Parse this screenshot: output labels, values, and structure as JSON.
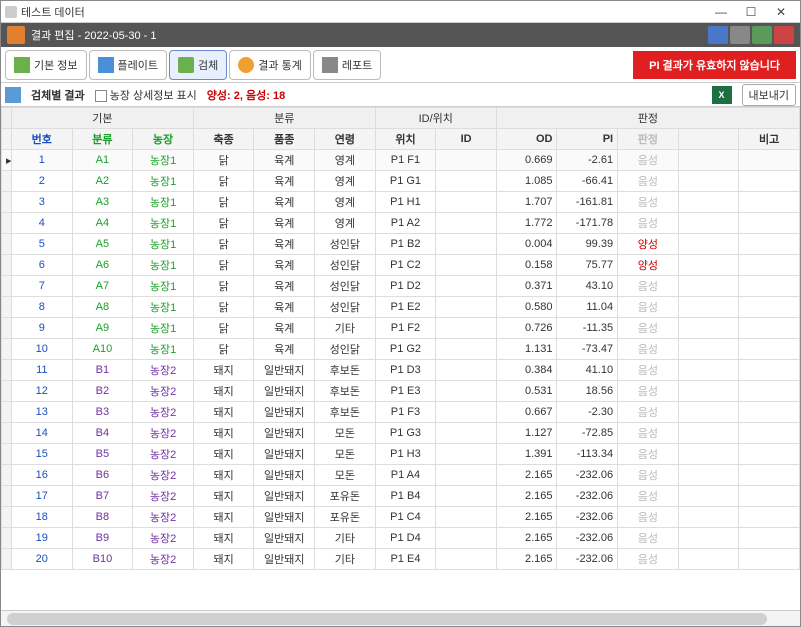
{
  "window": {
    "title": "테스트 데이터"
  },
  "editbar": {
    "title": "결과 편집 - 2022-05-30 - 1"
  },
  "toolbar": {
    "b1": "기본 정보",
    "b2": "플레이트",
    "b3": "검체",
    "b4": "결과 통계",
    "b5": "레포트",
    "warn": "PI 결과가 유효하지 않습니다"
  },
  "subbar": {
    "title": "검체별 결과",
    "chk_label": "농장 상세정보 표시",
    "stats": "양성: 2, 음성: 18",
    "export": "내보내기"
  },
  "group_headers": {
    "g1": "기본",
    "g2": "분류",
    "g3": "ID/위치",
    "g4": "판정"
  },
  "headers": {
    "seq": "번호",
    "cls": "분류",
    "farm": "농장",
    "sp": "축종",
    "br": "품종",
    "age": "연령",
    "pos": "위치",
    "id": "ID",
    "od": "OD",
    "pi": "PI",
    "jd": "판정",
    "note": "비고"
  },
  "rows": [
    {
      "n": "1",
      "c": "A1",
      "farm": "농장1",
      "sp": "닭",
      "br": "육계",
      "age": "영계",
      "pos": "P1 F1",
      "id": "",
      "od": "0.669",
      "pi": "-2.61",
      "jd": "음성",
      "fc": "g"
    },
    {
      "n": "2",
      "c": "A2",
      "farm": "농장1",
      "sp": "닭",
      "br": "육계",
      "age": "영계",
      "pos": "P1 G1",
      "id": "",
      "od": "1.085",
      "pi": "-66.41",
      "jd": "음성",
      "fc": "g"
    },
    {
      "n": "3",
      "c": "A3",
      "farm": "농장1",
      "sp": "닭",
      "br": "육계",
      "age": "영계",
      "pos": "P1 H1",
      "id": "",
      "od": "1.707",
      "pi": "-161.81",
      "jd": "음성",
      "fc": "g"
    },
    {
      "n": "4",
      "c": "A4",
      "farm": "농장1",
      "sp": "닭",
      "br": "육계",
      "age": "영계",
      "pos": "P1 A2",
      "id": "",
      "od": "1.772",
      "pi": "-171.78",
      "jd": "음성",
      "fc": "g"
    },
    {
      "n": "5",
      "c": "A5",
      "farm": "농장1",
      "sp": "닭",
      "br": "육계",
      "age": "성인닭",
      "pos": "P1 B2",
      "id": "",
      "od": "0.004",
      "pi": "99.39",
      "jd": "양성",
      "fc": "g",
      "pos_jd": true
    },
    {
      "n": "6",
      "c": "A6",
      "farm": "농장1",
      "sp": "닭",
      "br": "육계",
      "age": "성인닭",
      "pos": "P1 C2",
      "id": "",
      "od": "0.158",
      "pi": "75.77",
      "jd": "양성",
      "fc": "g",
      "pos_jd": true
    },
    {
      "n": "7",
      "c": "A7",
      "farm": "농장1",
      "sp": "닭",
      "br": "육계",
      "age": "성인닭",
      "pos": "P1 D2",
      "id": "",
      "od": "0.371",
      "pi": "43.10",
      "jd": "음성",
      "fc": "g"
    },
    {
      "n": "8",
      "c": "A8",
      "farm": "농장1",
      "sp": "닭",
      "br": "육계",
      "age": "성인닭",
      "pos": "P1 E2",
      "id": "",
      "od": "0.580",
      "pi": "11.04",
      "jd": "음성",
      "fc": "g"
    },
    {
      "n": "9",
      "c": "A9",
      "farm": "농장1",
      "sp": "닭",
      "br": "육계",
      "age": "기타",
      "pos": "P1 F2",
      "id": "",
      "od": "0.726",
      "pi": "-11.35",
      "jd": "음성",
      "fc": "g"
    },
    {
      "n": "10",
      "c": "A10",
      "farm": "농장1",
      "sp": "닭",
      "br": "육계",
      "age": "성인닭",
      "pos": "P1 G2",
      "id": "",
      "od": "1.131",
      "pi": "-73.47",
      "jd": "음성",
      "fc": "g"
    },
    {
      "n": "11",
      "c": "B1",
      "farm": "농장2",
      "sp": "돼지",
      "br": "일반돼지",
      "age": "후보돈",
      "pos": "P1 D3",
      "id": "",
      "od": "0.384",
      "pi": "41.10",
      "jd": "음성",
      "fc": "p"
    },
    {
      "n": "12",
      "c": "B2",
      "farm": "농장2",
      "sp": "돼지",
      "br": "일반돼지",
      "age": "후보돈",
      "pos": "P1 E3",
      "id": "",
      "od": "0.531",
      "pi": "18.56",
      "jd": "음성",
      "fc": "p"
    },
    {
      "n": "13",
      "c": "B3",
      "farm": "농장2",
      "sp": "돼지",
      "br": "일반돼지",
      "age": "후보돈",
      "pos": "P1 F3",
      "id": "",
      "od": "0.667",
      "pi": "-2.30",
      "jd": "음성",
      "fc": "p"
    },
    {
      "n": "14",
      "c": "B4",
      "farm": "농장2",
      "sp": "돼지",
      "br": "일반돼지",
      "age": "모돈",
      "pos": "P1 G3",
      "id": "",
      "od": "1.127",
      "pi": "-72.85",
      "jd": "음성",
      "fc": "p"
    },
    {
      "n": "15",
      "c": "B5",
      "farm": "농장2",
      "sp": "돼지",
      "br": "일반돼지",
      "age": "모돈",
      "pos": "P1 H3",
      "id": "",
      "od": "1.391",
      "pi": "-113.34",
      "jd": "음성",
      "fc": "p"
    },
    {
      "n": "16",
      "c": "B6",
      "farm": "농장2",
      "sp": "돼지",
      "br": "일반돼지",
      "age": "모돈",
      "pos": "P1 A4",
      "id": "",
      "od": "2.165",
      "pi": "-232.06",
      "jd": "음성",
      "fc": "p"
    },
    {
      "n": "17",
      "c": "B7",
      "farm": "농장2",
      "sp": "돼지",
      "br": "일반돼지",
      "age": "포유돈",
      "pos": "P1 B4",
      "id": "",
      "od": "2.165",
      "pi": "-232.06",
      "jd": "음성",
      "fc": "p"
    },
    {
      "n": "18",
      "c": "B8",
      "farm": "농장2",
      "sp": "돼지",
      "br": "일반돼지",
      "age": "포유돈",
      "pos": "P1 C4",
      "id": "",
      "od": "2.165",
      "pi": "-232.06",
      "jd": "음성",
      "fc": "p"
    },
    {
      "n": "19",
      "c": "B9",
      "farm": "농장2",
      "sp": "돼지",
      "br": "일반돼지",
      "age": "기타",
      "pos": "P1 D4",
      "id": "",
      "od": "2.165",
      "pi": "-232.06",
      "jd": "음성",
      "fc": "p"
    },
    {
      "n": "20",
      "c": "B10",
      "farm": "농장2",
      "sp": "돼지",
      "br": "일반돼지",
      "age": "기타",
      "pos": "P1 E4",
      "id": "",
      "od": "2.165",
      "pi": "-232.06",
      "jd": "음성",
      "fc": "p"
    }
  ]
}
